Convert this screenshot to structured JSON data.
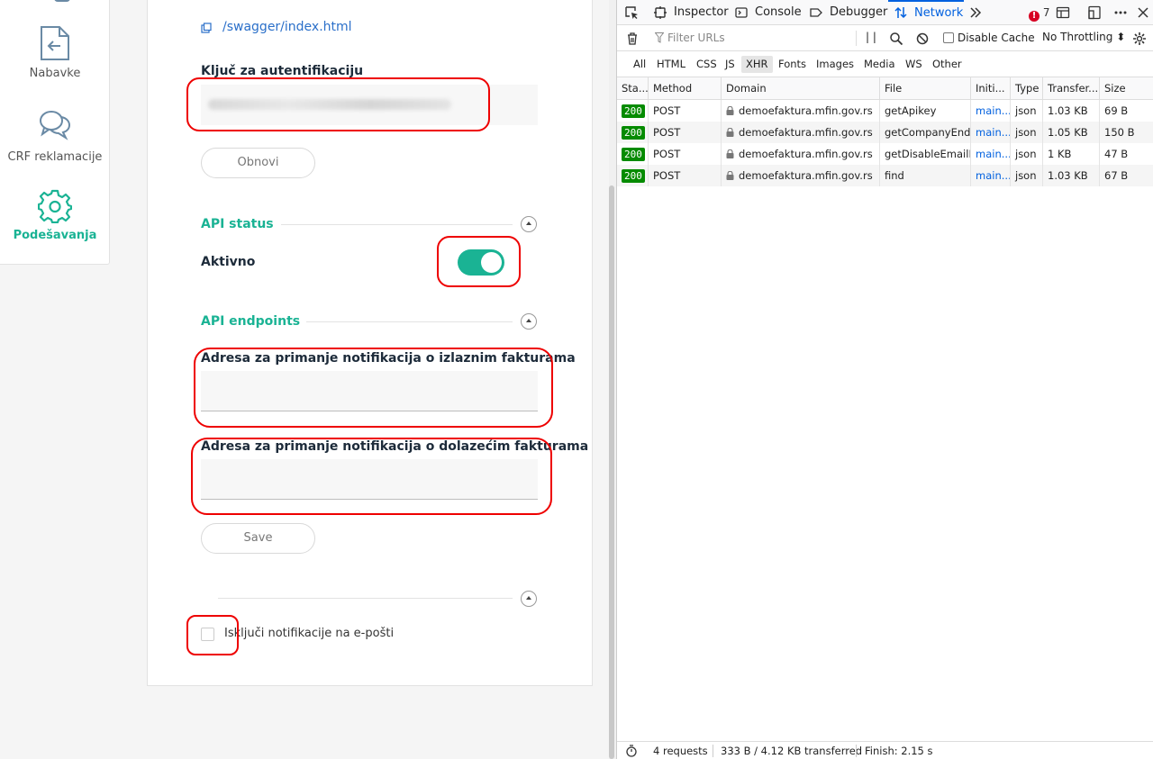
{
  "sidebar": {
    "items": [
      {
        "label": "Nabavke",
        "icon": "file-arrow-left-icon"
      },
      {
        "label": "CRF reklamacije",
        "icon": "chat-bubbles-icon"
      },
      {
        "label": "Podešavanja",
        "icon": "gear-icon",
        "active": true
      }
    ]
  },
  "settings": {
    "swagger_link": "/swagger/index.html",
    "auth_key_label": "Ključ za autentifikaciju",
    "refresh_button": "Obnovi",
    "api_status_title": "API status",
    "active_label": "Aktivno",
    "active_toggle": true,
    "api_endpoints_title": "API endpoints",
    "outgoing_label": "Adresa za primanje notifikacija o izlaznim fakturama",
    "outgoing_value": "",
    "incoming_label": "Adresa za primanje notifikacija o dolazećim fakturama",
    "incoming_value": "",
    "save_button": "Save",
    "email_disable_label": "Isključi notifikacije na e-pošti",
    "email_disable_checked": false
  },
  "devtools": {
    "tabs": [
      "Inspector",
      "Console",
      "Debugger",
      "Network"
    ],
    "active_tab": "Network",
    "error_count": "7",
    "filter_placeholder": "Filter URLs",
    "pause_label": "| |",
    "disable_cache": "Disable Cache",
    "throttling": "No Throttling ⬍",
    "filter_tabs": [
      "All",
      "HTML",
      "CSS",
      "JS",
      "XHR",
      "Fonts",
      "Images",
      "Media",
      "WS",
      "Other"
    ],
    "active_filter": "XHR",
    "columns": [
      "Sta...",
      "Method",
      "Domain",
      "File",
      "Initi...",
      "Type",
      "Transfer...",
      "Size"
    ],
    "rows": [
      {
        "status": "200",
        "method": "POST",
        "domain": "demoefaktura.mfin.gov.rs",
        "file": "getApikey",
        "initiator": "main...",
        "type": "json",
        "transferred": "1.03 KB",
        "size": "69 B"
      },
      {
        "status": "200",
        "method": "POST",
        "domain": "demoefaktura.mfin.gov.rs",
        "file": "getCompanyEndp",
        "initiator": "main...",
        "type": "json",
        "transferred": "1.05 KB",
        "size": "150 B"
      },
      {
        "status": "200",
        "method": "POST",
        "domain": "demoefaktura.mfin.gov.rs",
        "file": "getDisableEmailNo",
        "initiator": "main...",
        "type": "json",
        "transferred": "1 KB",
        "size": "47 B"
      },
      {
        "status": "200",
        "method": "POST",
        "domain": "demoefaktura.mfin.gov.rs",
        "file": "find",
        "initiator": "main...",
        "type": "json",
        "transferred": "1.03 KB",
        "size": "67 B"
      }
    ],
    "status_bar": {
      "requests": "4 requests",
      "transferred": "333 B / 4.12 KB transferred",
      "finish": "Finish: 2.15 s"
    }
  },
  "colors": {
    "accent": "#1ab394",
    "highlight": "#e00000",
    "link": "#2a6fc9",
    "status_ok": "#058b00"
  }
}
